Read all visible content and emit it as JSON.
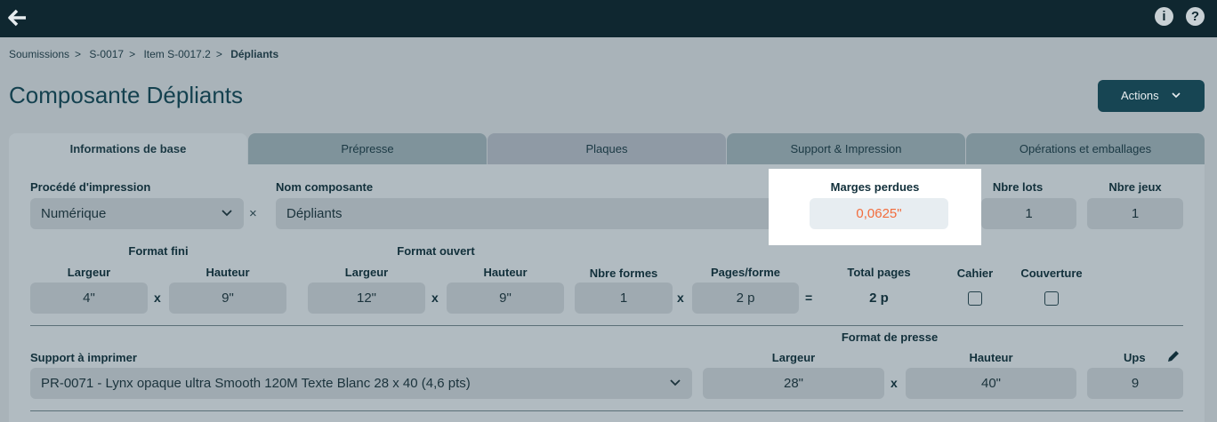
{
  "topbar": {
    "back_icon": "arrow-left-icon",
    "info_icon": "info-icon",
    "help_icon": "help-icon",
    "info_glyph": "i",
    "help_glyph": "?"
  },
  "breadcrumb": [
    "Soumissions",
    "S-0017",
    "Item S-0017.2",
    "Dépliants"
  ],
  "breadcrumb_sep": ">",
  "page_title": "Composante Dépliants",
  "actions_label": "Actions",
  "tabs": [
    "Informations de base",
    "Prépresse",
    "Plaques",
    "Support & Impression",
    "Opérations et emballages"
  ],
  "form": {
    "procede_label": "Procédé d'impression",
    "procede_value": "Numérique",
    "clear_glyph": "×",
    "nom_label": "Nom composante",
    "nom_value": "Dépliants",
    "marges_label": "Marges perdues",
    "marges_value": "0,0625\"",
    "nbre_lots_label": "Nbre lots",
    "nbre_lots_value": "1",
    "nbre_jeux_label": "Nbre jeux",
    "nbre_jeux_value": "1",
    "format_fini_label": "Format fini",
    "format_ouvert_label": "Format ouvert",
    "largeur_label": "Largeur",
    "hauteur_label": "Hauteur",
    "fini_largeur": "4\"",
    "fini_hauteur": "9\"",
    "ouvert_largeur": "12\"",
    "ouvert_hauteur": "9\"",
    "nbre_formes_label": "Nbre formes",
    "nbre_formes_value": "1",
    "pages_forme_label": "Pages/forme",
    "pages_forme_value": "2 p",
    "total_pages_label": "Total pages",
    "total_pages_value": "2 p",
    "cahier_label": "Cahier",
    "couverture_label": "Couverture",
    "op_x": "x",
    "op_eq": "=",
    "support_label": "Support à imprimer",
    "support_value": "PR-0071 - Lynx opaque ultra Smooth 120M Texte Blanc 28 x 40 (4,6 pts)",
    "format_presse_label": "Format de presse",
    "presse_largeur": "28\"",
    "presse_hauteur": "40\"",
    "ups_label": "Ups",
    "ups_value": "9"
  },
  "colors": {
    "topbar": "#0f2730",
    "accent": "#174553",
    "highlight_text": "#f26c3c"
  }
}
